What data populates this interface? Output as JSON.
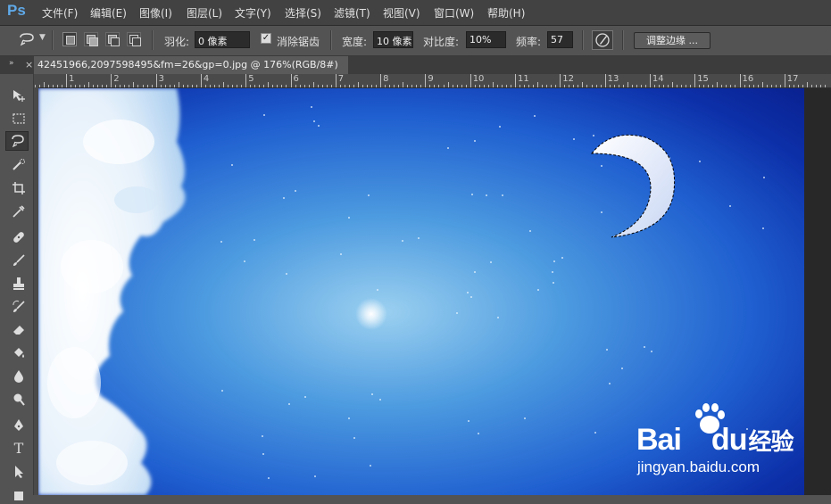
{
  "app": {
    "logo": "Ps"
  },
  "menu": [
    "文件(F)",
    "编辑(E)",
    "图像(I)",
    "图层(L)",
    "文字(Y)",
    "选择(S)",
    "滤镜(T)",
    "视图(V)",
    "窗口(W)",
    "帮助(H)"
  ],
  "options": {
    "feather_label": "羽化:",
    "feather_value": "0 像素",
    "antialias_label": "消除锯齿",
    "antialias_checked": true,
    "width_label": "宽度:",
    "width_value": "10 像素",
    "contrast_label": "对比度:",
    "contrast_value": "10%",
    "frequency_label": "频率:",
    "frequency_value": "57",
    "refine_edge_label": "调整边缘 ..."
  },
  "document": {
    "tab_title": "42451966,2097598495&fm=26&gp=0.jpg @ 176%(RGB/8#)",
    "close_glyph": "×",
    "collapse_glyph": "»"
  },
  "ruler": {
    "labels": [
      "1",
      "2",
      "3",
      "4",
      "5",
      "6",
      "7",
      "8",
      "9",
      "10",
      "11",
      "12",
      "13",
      "14",
      "15",
      "16",
      "17"
    ]
  },
  "tools": [
    {
      "name": "move-tool",
      "icon": "move-icon"
    },
    {
      "name": "marquee-tool",
      "icon": "rect-marquee-icon"
    },
    {
      "name": "lasso-tool",
      "icon": "magnetic-lasso-icon",
      "active": true
    },
    {
      "name": "quick-selection-tool",
      "icon": "quick-select-icon"
    },
    {
      "name": "crop-tool",
      "icon": "crop-icon"
    },
    {
      "name": "eyedropper-tool",
      "icon": "eyedropper-icon"
    },
    {
      "name": "healing-tool",
      "icon": "bandage-icon"
    },
    {
      "name": "brush-tool",
      "icon": "brush-icon"
    },
    {
      "name": "stamp-tool",
      "icon": "stamp-icon"
    },
    {
      "name": "history-brush-tool",
      "icon": "history-brush-icon"
    },
    {
      "name": "eraser-tool",
      "icon": "eraser-icon"
    },
    {
      "name": "paint-bucket-tool",
      "icon": "bucket-icon"
    },
    {
      "name": "blur-tool",
      "icon": "drop-icon"
    },
    {
      "name": "dodge-tool",
      "icon": "dodge-icon"
    },
    {
      "name": "pen-tool",
      "icon": "pen-icon"
    },
    {
      "name": "type-tool",
      "icon": "type-icon",
      "glyph": "T"
    },
    {
      "name": "path-selection-tool",
      "icon": "path-select-icon"
    },
    {
      "name": "shape-tool",
      "icon": "shape-icon"
    }
  ],
  "watermark": {
    "brand_left": "Bai",
    "brand_right": "du",
    "brand_cn": "经验",
    "url": "jingyan.baidu.com"
  },
  "colors": {
    "menubar_bg": "#424242",
    "panel_bg": "#535353",
    "sky_dark": "#0a2190",
    "sky_light": "#9bd0f0",
    "ps_blue": "#5fa9e8"
  }
}
